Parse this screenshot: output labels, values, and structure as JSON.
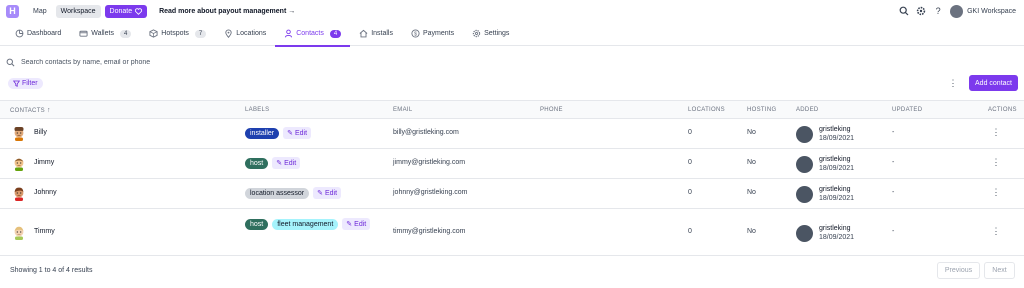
{
  "topbar": {
    "logo_letter": "H",
    "links": [
      "Map",
      "Workspace"
    ],
    "donate_label": "Donate",
    "promo": "Read more about payout management →",
    "workspace_name": "GKI Workspace"
  },
  "tabs": [
    {
      "label": "Dashboard",
      "icon": "dashboard-icon"
    },
    {
      "label": "Wallets",
      "icon": "wallet-icon",
      "count": "4"
    },
    {
      "label": "Hotspots",
      "icon": "hotspot-icon",
      "count": "7"
    },
    {
      "label": "Locations",
      "icon": "location-pin-icon"
    },
    {
      "label": "Contacts",
      "icon": "contact-icon",
      "count": "4",
      "active": true
    },
    {
      "label": "Installs",
      "icon": "home-icon"
    },
    {
      "label": "Payments",
      "icon": "dollar-icon"
    },
    {
      "label": "Settings",
      "icon": "gear-icon"
    }
  ],
  "search": {
    "placeholder": "Search contacts by name, email or phone"
  },
  "filter_label": "Filter",
  "add_contact_label": "Add contact",
  "table": {
    "columns": [
      "CONTACTS",
      "LABELS",
      "EMAIL",
      "PHONE",
      "LOCATIONS",
      "HOSTING",
      "ADDED",
      "UPDATED",
      "ACTIONS"
    ],
    "edit_label": "Edit",
    "rows": [
      {
        "name": "Billy",
        "labels": [
          {
            "text": "installer",
            "color": "#1e40af"
          }
        ],
        "email": "billy@gristleking.com",
        "phone": "",
        "locations": "0",
        "hosting": "No",
        "added_by": "gristleking",
        "added_date": "18/09/2021",
        "updated": "-"
      },
      {
        "name": "Jimmy",
        "labels": [
          {
            "text": "host",
            "color": "#2f6f5e"
          }
        ],
        "email": "jimmy@gristleking.com",
        "phone": "",
        "locations": "0",
        "hosting": "No",
        "added_by": "gristleking",
        "added_date": "18/09/2021",
        "updated": "-"
      },
      {
        "name": "Johnny",
        "labels": [
          {
            "text": "location assessor",
            "color": "#d1d5db",
            "text_color": "#111827"
          }
        ],
        "email": "johnny@gristleking.com",
        "phone": "",
        "locations": "0",
        "hosting": "No",
        "added_by": "gristleking",
        "added_date": "18/09/2021",
        "updated": "-"
      },
      {
        "name": "Timmy",
        "labels": [
          {
            "text": "host",
            "color": "#2f6f5e"
          },
          {
            "text": "fleet management",
            "color": "#a5f3fc",
            "text_color": "#111827"
          }
        ],
        "email": "timmy@gristleking.com",
        "phone": "",
        "locations": "0",
        "hosting": "No",
        "added_by": "gristleking",
        "added_date": "18/09/2021",
        "updated": "-"
      }
    ]
  },
  "footer": {
    "summary": "Showing 1 to 4 of 4 results",
    "previous": "Previous",
    "next": "Next"
  }
}
